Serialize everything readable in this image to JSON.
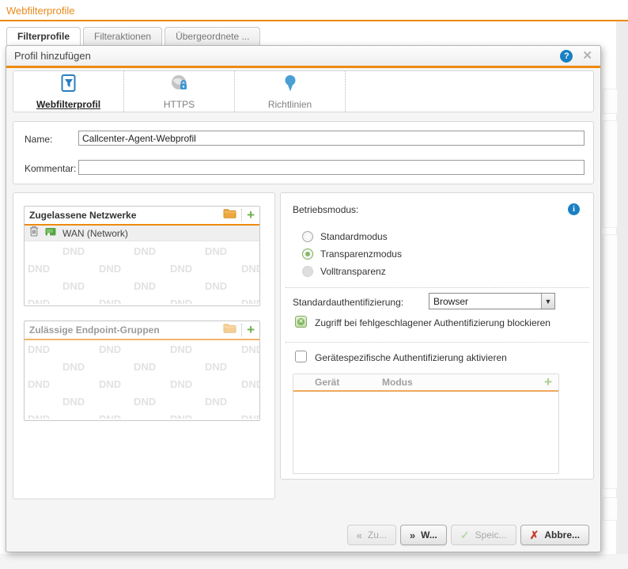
{
  "page": {
    "title": "Webfilterprofile",
    "tabs": [
      {
        "label": "Filterprofile"
      },
      {
        "label": "Filteraktionen"
      },
      {
        "label": "Übergeordnete ..."
      }
    ]
  },
  "icons": {
    "help": "?",
    "close": "✕",
    "info": "i",
    "plus": "+",
    "dropdown_arrow": "▼",
    "back_chevrons": "«",
    "forward_chevrons": "»",
    "check": "✓",
    "cancel_x": "✗"
  },
  "colors": {
    "accent_orange": "#EE8A0E",
    "icon_blue": "#1A80C4",
    "action_green": "#6FAE4E",
    "cancel_red": "#C63C2E"
  },
  "dialog": {
    "title": "Profil hinzufügen",
    "steps": [
      {
        "label": "Webfilterprofil"
      },
      {
        "label": "HTTPS"
      },
      {
        "label": "Richtlinien"
      }
    ],
    "form": {
      "name_label": "Name:",
      "name_value": "Callcenter-Agent-Webprofil",
      "comment_label": "Kommentar:",
      "comment_value": ""
    },
    "networks_panel": {
      "title": "Zugelassene Netzwerke",
      "dnd_text": "DND",
      "items": [
        {
          "label": "WAN (Network)"
        }
      ]
    },
    "endpoint_panel": {
      "title": "Zulässige Endpoint-Gruppen",
      "dnd_text": "DND"
    },
    "operation_mode": {
      "label": "Betriebsmodus:",
      "options": [
        {
          "label": "Standardmodus",
          "state": "unchecked"
        },
        {
          "label": "Transparenzmodus",
          "state": "selected"
        },
        {
          "label": "Volltransparenz",
          "state": "disabled"
        }
      ]
    },
    "default_auth": {
      "label": "Standardauthentifizierung:",
      "value": "Browser"
    },
    "auth_block_checkbox": {
      "label": "Zugriff bei fehlgeschlagener Authentifizierung blockieren",
      "checked": true
    },
    "device_auth_checkbox": {
      "label": "Gerätespezifische Authentifizierung aktivieren",
      "checked": false
    },
    "device_table": {
      "columns": [
        "Gerät",
        "Modus"
      ]
    },
    "footer": {
      "back_label": "Zu...",
      "next_label": "W...",
      "save_label": "Speic...",
      "cancel_label": "Abbre..."
    }
  }
}
